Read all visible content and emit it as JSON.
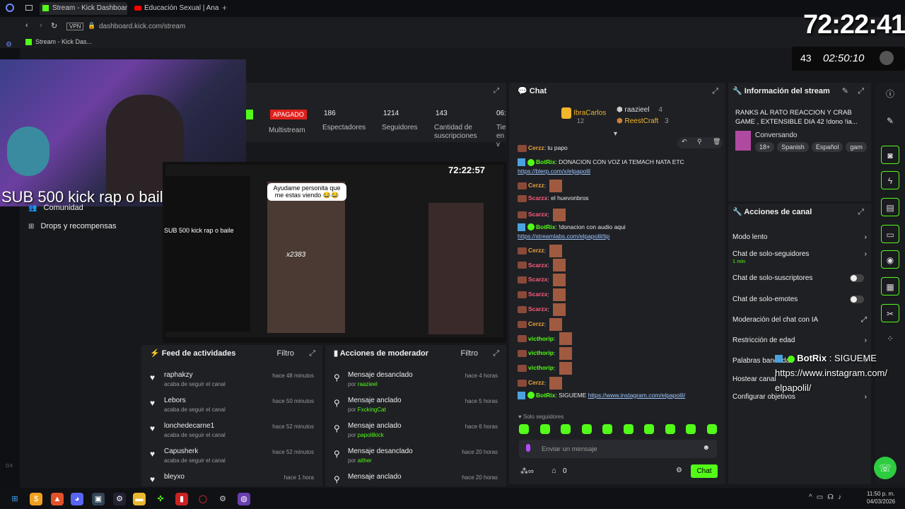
{
  "browser": {
    "tabs": [
      "Stream - Kick Dashboard",
      "Educación Sexual | Ana T..."
    ],
    "url": "dashboard.kick.com/stream",
    "vpn": "VPN",
    "bookmark": "Stream - Kick Das..."
  },
  "overlay": {
    "big_timer": "72:22:41",
    "small_timer": "02:50:10",
    "days": "43",
    "sub_text": "SUB 500 kick  rap o  baile",
    "botrix_msg": {
      "user": "BotRix",
      "sep": ":",
      "text": "SIGUEME",
      "link1": "https://www.instagram.com/",
      "link2": "elpapolil/"
    }
  },
  "left_nav": {
    "comunidad": "Comunidad",
    "drops": "Drops y recompensas"
  },
  "stats": {
    "status": "APAGADO",
    "multistream": "Multistream",
    "espectadores_val": "186",
    "espectadores": "Espectadores",
    "seguidores_val": "1214",
    "seguidores": "Seguidores",
    "suscripciones_val": "143",
    "suscripciones": "Cantidad de suscripciones",
    "tiempo_val": "06:",
    "tiempo": "Tie en v"
  },
  "preview": {
    "timer": "72:22:57",
    "bubble": "Ayudame personita que me estas viendo 😂😂",
    "multiplier": "x2383",
    "sub_text": "SUB 500 kick  rap o  baile"
  },
  "activity": {
    "title": "Feed de actividades",
    "filter": "Filtro",
    "items": [
      {
        "name": "raphakzy",
        "sub": "acaba de seguir el canal",
        "time": "hace 48 minutos"
      },
      {
        "name": "Lebors",
        "sub": "acaba de seguir el canal",
        "time": "hace 50 minutos"
      },
      {
        "name": "lonchedecarne1",
        "sub": "acaba de seguir el canal",
        "time": "hace 52 minutos"
      },
      {
        "name": "Capusherk",
        "sub": "acaba de seguir el canal",
        "time": "hace 52 minutos"
      },
      {
        "name": "bleyxo",
        "sub": "",
        "time": "hace 1 hora"
      }
    ]
  },
  "mod": {
    "title": "Acciones de moderador",
    "filter": "Filtro",
    "items": [
      {
        "name": "Mensaje desanclado",
        "by": "por",
        "user": "raazieel",
        "time": "hace 4 horas"
      },
      {
        "name": "Mensaje anclado",
        "by": "por",
        "user": "FxckingCat",
        "time": "hace 5 horas"
      },
      {
        "name": "Mensaje anclado",
        "by": "por",
        "user": "papolilkick",
        "time": "hace 6 horas"
      },
      {
        "name": "Mensaje desanclado",
        "by": "por",
        "user": "aither",
        "time": "hace 20 horas"
      },
      {
        "name": "Mensaje anclado",
        "by": "",
        "user": "",
        "time": "hace 20 horas"
      }
    ]
  },
  "chat": {
    "title": "Chat",
    "top": [
      {
        "name": "IbraCarlos",
        "count": "12"
      },
      {
        "name": "raazieel",
        "count": "4"
      },
      {
        "name": "ReestCraft",
        "count": "3"
      }
    ],
    "messages": [
      {
        "user": "Cerzz",
        "text": "tu papo",
        "color": "#e8a23c",
        "type": "user"
      },
      {
        "user": "BotRix",
        "text": "DONACION CON VOZ IA TEMACH NATA ETC",
        "link": "https://blerp.com/x/elpapolil",
        "color": "#53fc18",
        "type": "bot"
      },
      {
        "user": "Cerzz",
        "text": "",
        "color": "#e8a23c",
        "type": "emote"
      },
      {
        "user": "Scarzx",
        "text": "el huevonbros",
        "color": "#ff5a7a",
        "type": "user"
      },
      {
        "user": "Scarzx",
        "text": "",
        "color": "#ff5a7a",
        "type": "emote"
      },
      {
        "user": "BotRix",
        "text": "!donacion con audio aqui",
        "link": "https://streamlabs.com/elpapolil/tip",
        "color": "#53fc18",
        "type": "bot"
      },
      {
        "user": "Cerzz",
        "text": "",
        "color": "#e8a23c",
        "type": "emote"
      },
      {
        "user": "Scarzx",
        "text": "",
        "color": "#ff5a7a",
        "type": "emote"
      },
      {
        "user": "Scarzx",
        "text": "",
        "color": "#ff5a7a",
        "type": "emote"
      },
      {
        "user": "Scarzx",
        "text": "",
        "color": "#ff5a7a",
        "type": "emote"
      },
      {
        "user": "Scarzx",
        "text": "",
        "color": "#ff5a7a",
        "type": "emote"
      },
      {
        "user": "Cerzz",
        "text": "",
        "color": "#e8a23c",
        "type": "emote"
      },
      {
        "user": "victhorip",
        "text": "",
        "color": "#53fc18",
        "type": "emote"
      },
      {
        "user": "victhorip",
        "text": "",
        "color": "#53fc18",
        "type": "emote"
      },
      {
        "user": "victhorip",
        "text": "",
        "color": "#53fc18",
        "type": "emote"
      },
      {
        "user": "Cerzz",
        "text": "",
        "color": "#e8a23c",
        "type": "emote"
      },
      {
        "user": "BotRix",
        "text": "SIGUEME",
        "link": "https://www.instagram.com/elpapolil/",
        "color": "#53fc18",
        "type": "bot"
      }
    ],
    "followers_only": "Solo seguidores",
    "placeholder": "Enviar un mensaje",
    "points": "0",
    "send": "Chat"
  },
  "stream_info": {
    "title": "Información del stream",
    "stream_title": "RANKS AL RATO REACCION Y CRAB GAME , EXTENSIBLE DIA 42 !dono !ia...",
    "category": "Conversando",
    "tags": [
      "18+",
      "Spanish",
      "Español",
      "gam"
    ]
  },
  "channel_actions": {
    "title": "Acciones de canal",
    "items": [
      {
        "label": "Modo lento",
        "sub": "",
        "kind": "chevron"
      },
      {
        "label": "Chat de solo-seguidores",
        "sub": "1 min",
        "kind": "chevron"
      },
      {
        "label": "Chat de solo-suscriptores",
        "sub": "",
        "kind": "toggle"
      },
      {
        "label": "Chat de solo-emotes",
        "sub": "",
        "kind": "toggle"
      },
      {
        "label": "Moderación del chat con IA",
        "sub": "",
        "kind": "ext"
      },
      {
        "label": "Restricción de edad",
        "sub": "",
        "kind": "chevron"
      },
      {
        "label": "Palabras baneadas",
        "sub": "",
        "kind": "chevron"
      },
      {
        "label": "Hostear canal",
        "sub": "",
        "kind": "none"
      },
      {
        "label": "Configurar objetivos",
        "sub": "",
        "kind": "chevron"
      }
    ]
  },
  "taskbar": {
    "time": "11:50 p. m.",
    "date": "04/03/2026"
  },
  "colors": {
    "accent": "#53fc18",
    "bg": "#17181b",
    "panel": "#1f2024"
  }
}
